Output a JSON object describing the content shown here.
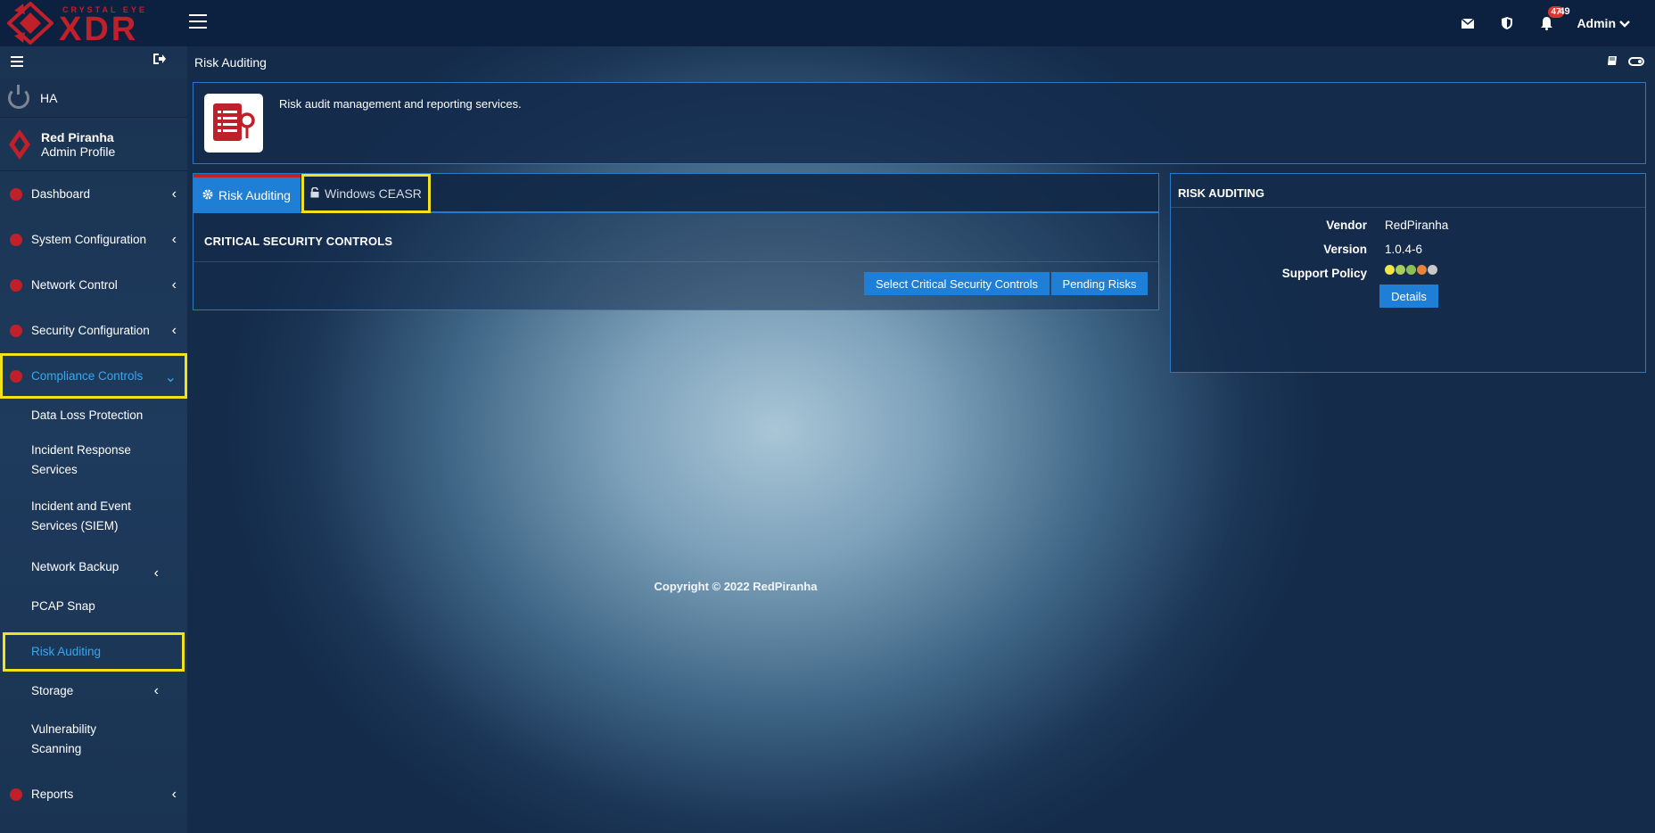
{
  "brand": {
    "tagline": "CRYSTAL EYE",
    "product": "XDR",
    "accent_color": "#c0202a"
  },
  "topbar": {
    "notifications_badge": "47",
    "notifications_count": "49",
    "user_label": "Admin",
    "icons": [
      "envelope-icon",
      "shield-icon",
      "bell-icon"
    ]
  },
  "sidebar": {
    "ha_label": "HA",
    "profile_name": "Red Piranha",
    "profile_role": "Admin Profile",
    "items": [
      {
        "label": "Dashboard"
      },
      {
        "label": "System Configuration"
      },
      {
        "label": "Network Control"
      },
      {
        "label": "Security Configuration"
      },
      {
        "label": "Compliance Controls"
      }
    ],
    "sub_items": [
      {
        "label": "Data Loss Protection"
      },
      {
        "label": "Incident Response Services"
      },
      {
        "label": "Incident and Event Services (SIEM)"
      },
      {
        "label": "Network Backup"
      },
      {
        "label": "PCAP Snap"
      },
      {
        "label": "Risk Auditing"
      },
      {
        "label": "Storage"
      },
      {
        "label": "Vulnerability Scanning"
      }
    ],
    "reports_label": "Reports"
  },
  "page": {
    "title": "Risk Auditing",
    "description": "Risk audit management and reporting services.",
    "tabs": [
      {
        "label": "Risk Auditing"
      },
      {
        "label": "Windows CEASR"
      }
    ],
    "section_title": "CRITICAL SECURITY CONTROLS",
    "buttons": {
      "select": "Select Critical Security Controls",
      "pending": "Pending Risks"
    }
  },
  "side_panel": {
    "title": "RISK AUDITING",
    "vendor_label": "Vendor",
    "vendor_value": "RedPiranha",
    "version_label": "Version",
    "version_value": "1.0.4-6",
    "support_label": "Support Policy",
    "support_dots": [
      "#f1e646",
      "#a9cf54",
      "#8cc152",
      "#e8843a",
      "#c8c8c8"
    ],
    "details_label": "Details"
  },
  "footer": {
    "copyright": "Copyright © 2022 RedPiranha"
  },
  "colors": {
    "highlight": "#f2e21a",
    "primary_button": "#1f7fd6",
    "active_link": "#3aa6f0"
  }
}
